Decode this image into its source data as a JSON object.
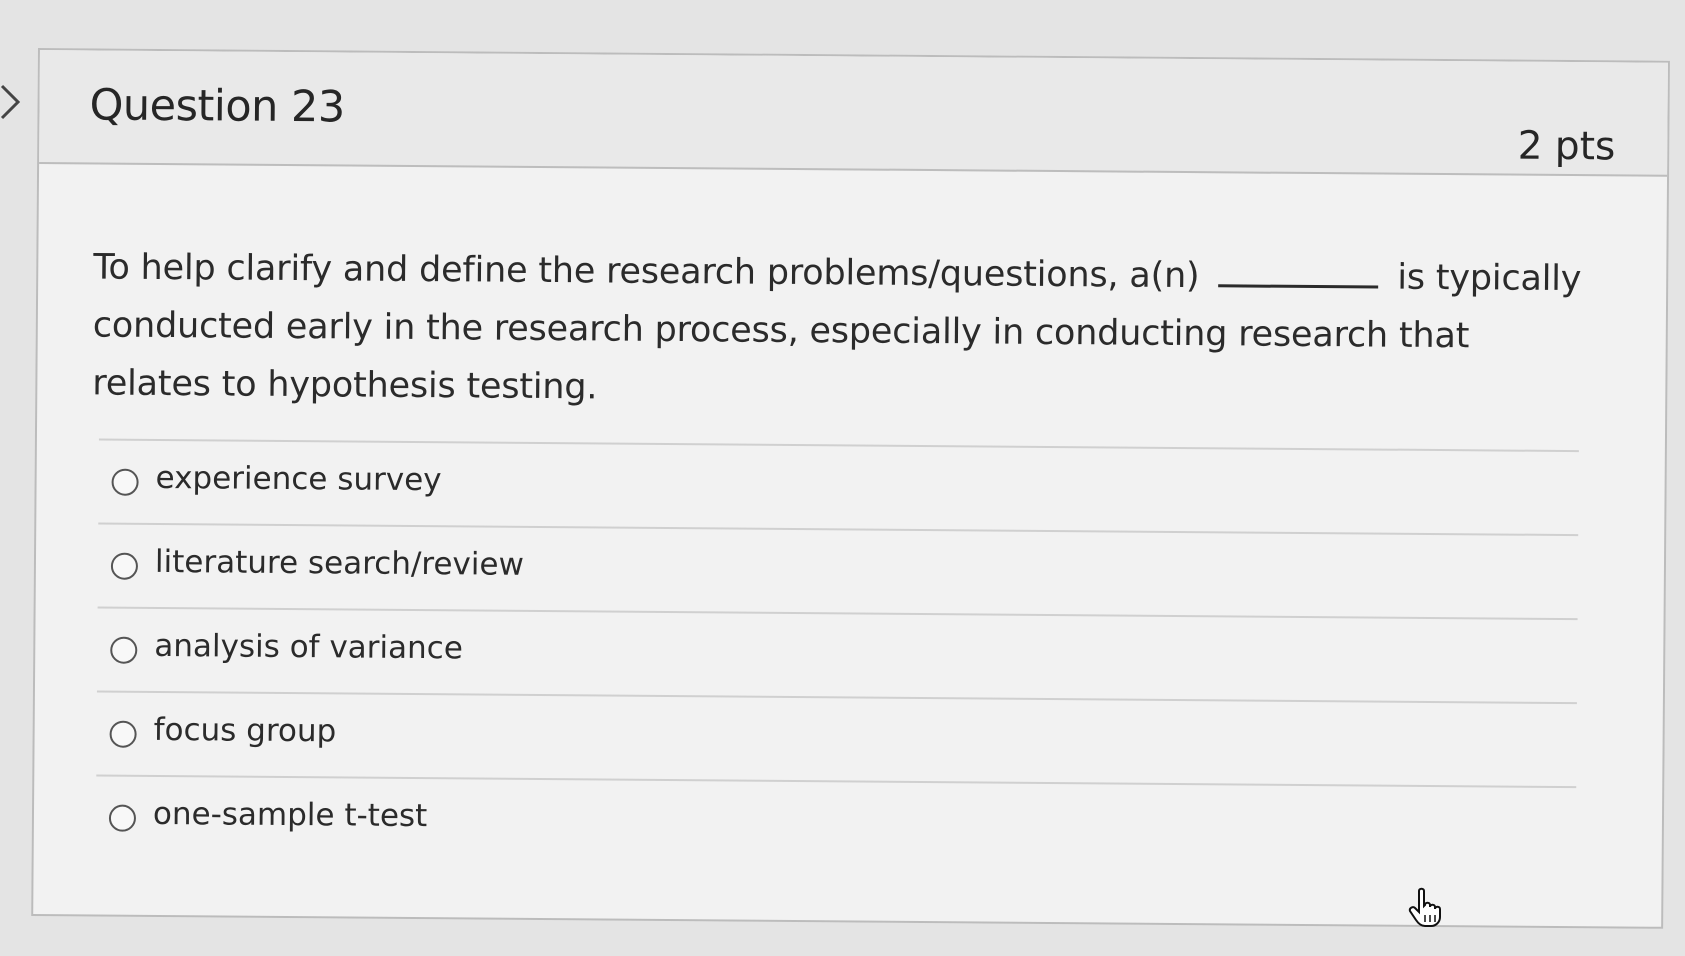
{
  "question": {
    "title": "Question 23",
    "points": "2 pts",
    "text_before": "To help clarify and define the research problems/questions, a(n)",
    "text_after": "is typically conducted early in the research process, especially in conducting research that relates to hypothesis testing."
  },
  "answers": [
    {
      "label": "experience survey",
      "selected": false
    },
    {
      "label": "literature search/review",
      "selected": false
    },
    {
      "label": "analysis of variance",
      "selected": false
    },
    {
      "label": "focus group",
      "selected": false
    },
    {
      "label": "one-sample t-test",
      "selected": false
    }
  ],
  "icons": {
    "left_nav": "chevron-right-icon",
    "cursor": "hand-pointer-icon"
  }
}
